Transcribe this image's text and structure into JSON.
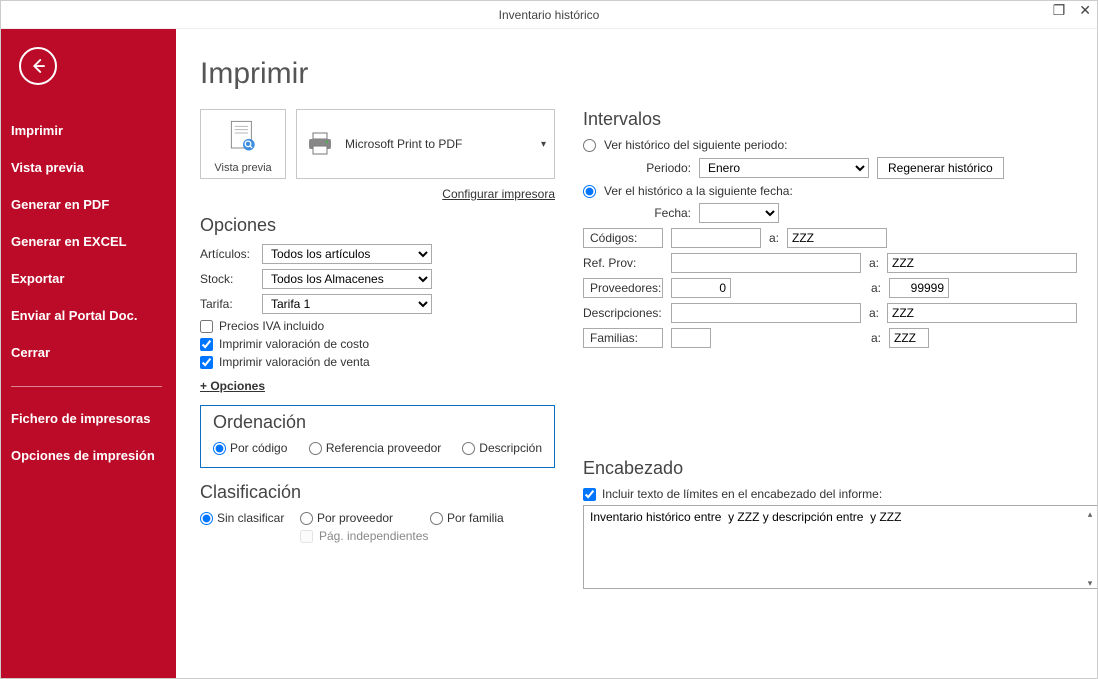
{
  "window": {
    "title": "Inventario histórico"
  },
  "sidebar": {
    "items": [
      "Imprimir",
      "Vista previa",
      "Generar en PDF",
      "Generar en EXCEL",
      "Exportar",
      "Enviar al Portal Doc.",
      "Cerrar"
    ],
    "items2": [
      "Fichero de impresoras",
      "Opciones de impresión"
    ]
  },
  "page": {
    "title": "Imprimir"
  },
  "preview": {
    "label": "Vista previa"
  },
  "printer": {
    "name": "Microsoft Print to PDF"
  },
  "links": {
    "configure_printer": "Configurar impresora"
  },
  "opciones": {
    "heading": "Opciones",
    "articulos_label": "Artículos:",
    "articulos_value": "Todos los artículos",
    "stock_label": "Stock:",
    "stock_value": "Todos los Almacenes",
    "tarifa_label": "Tarifa:",
    "tarifa_value": "Tarifa 1",
    "precios_iva": "Precios IVA incluido",
    "val_costo": "Imprimir valoración de costo",
    "val_venta": "Imprimir valoración de venta",
    "more": "+ Opciones"
  },
  "ordenacion": {
    "heading": "Ordenación",
    "por_codigo": "Por código",
    "ref_prov": "Referencia proveedor",
    "descripcion": "Descripción"
  },
  "clasificacion": {
    "heading": "Clasificación",
    "sin": "Sin clasificar",
    "por_prov": "Por proveedor",
    "por_fam": "Por familia",
    "pag_indep": "Pág. independientes"
  },
  "intervalos": {
    "heading": "Intervalos",
    "radio_periodo": "Ver histórico del siguiente periodo:",
    "periodo_label": "Periodo:",
    "periodo_value": "Enero",
    "regenerar": "Regenerar histórico",
    "radio_fecha": "Ver el histórico a la siguiente fecha:",
    "fecha_label": "Fecha:",
    "fecha_value": "",
    "codigos_label": "Códigos:",
    "codigos_from": "",
    "codigos_to": "ZZZ",
    "a": "a:",
    "refprov_label": "Ref. Prov:",
    "refprov_from": "",
    "refprov_to": "ZZZ",
    "proveedores_label": "Proveedores:",
    "proveedores_from": "0",
    "proveedores_to": "99999",
    "descripciones_label": "Descripciones:",
    "descripciones_from": "",
    "descripciones_to": "ZZZ",
    "familias_label": "Familias:",
    "familias_from": "",
    "familias_to": "ZZZ"
  },
  "encabezado": {
    "heading": "Encabezado",
    "include_limits": "Incluir texto de límites en el encabezado del informe:",
    "text": "Inventario histórico entre  y ZZZ y descripción entre  y ZZZ"
  }
}
